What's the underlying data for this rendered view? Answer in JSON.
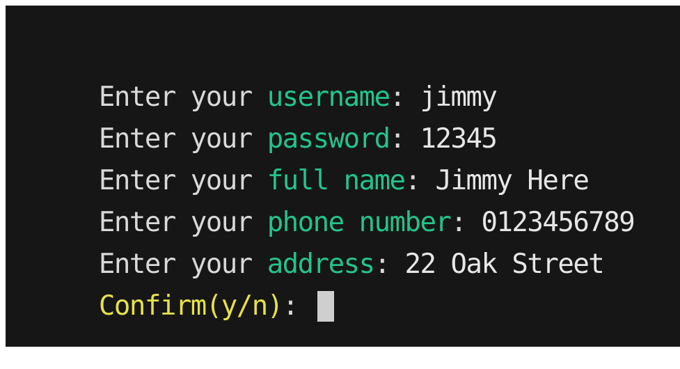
{
  "terminal": {
    "lines": [
      {
        "prompt": "Enter your ",
        "field": "username",
        "sep": ": ",
        "value": "jimmy"
      },
      {
        "prompt": "Enter your ",
        "field": "password",
        "sep": ": ",
        "value": "12345"
      },
      {
        "prompt": "Enter your ",
        "field": "full name",
        "sep": ": ",
        "value": "Jimmy Here"
      },
      {
        "prompt": "Enter your ",
        "field": "phone number",
        "sep": ": ",
        "value": "0123456789"
      },
      {
        "prompt": "Enter your ",
        "field": "address",
        "sep": ": ",
        "value": "22 Oak Street"
      }
    ],
    "confirm": {
      "label": "Confirm(y/n)",
      "sep": ": "
    },
    "colors": {
      "background": "#161616",
      "text": "#d9d9d9",
      "field": "#23c48a",
      "confirm": "#e6e04a",
      "cursor": "#cfcfcf"
    }
  }
}
